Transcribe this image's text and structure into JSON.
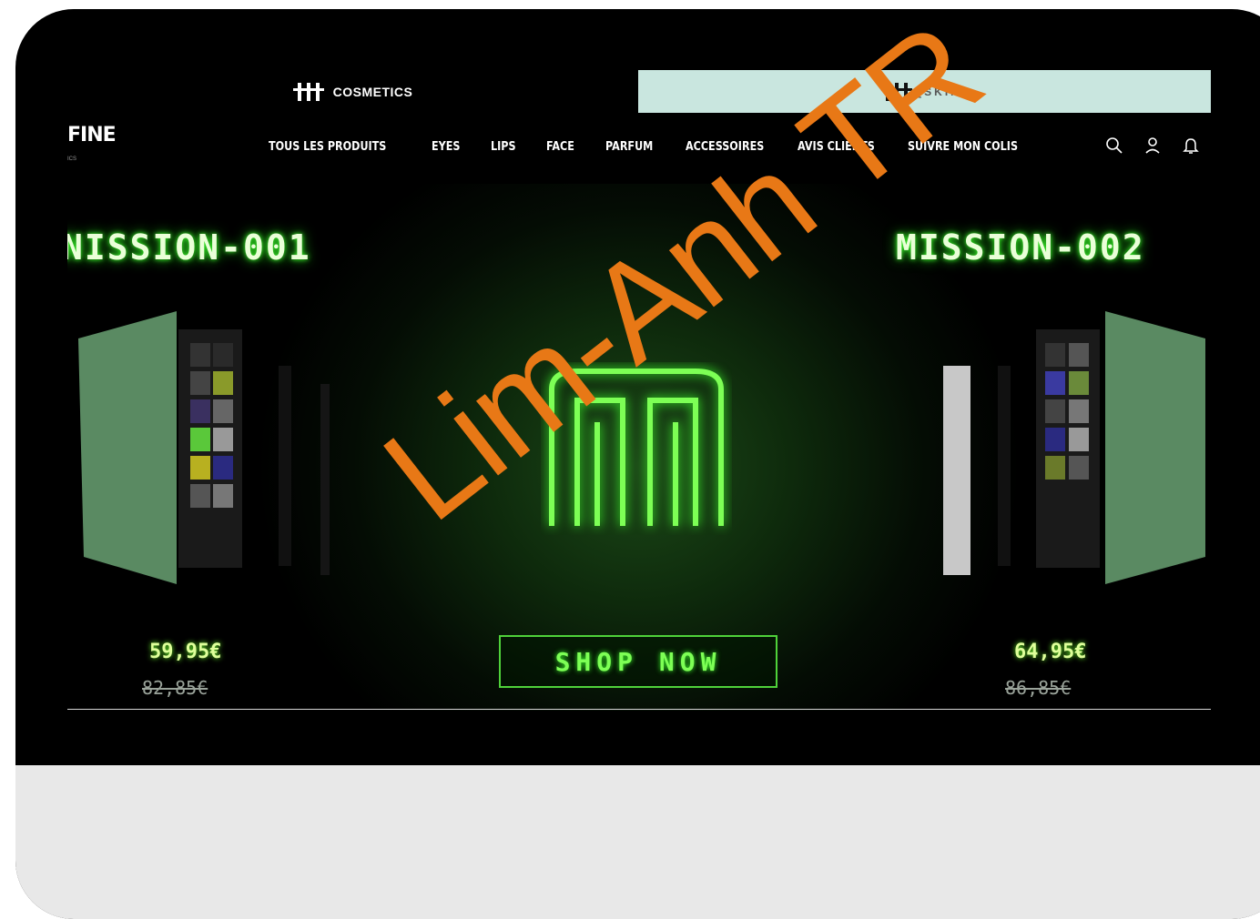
{
  "brand_switch": {
    "cosmetics_label": "COSMETICS",
    "skin_label": "[SKIN]"
  },
  "nav": {
    "logo": "FINE",
    "logo_sub": "ICS",
    "items": [
      {
        "label": "TOUS LES PRODUITS"
      },
      {
        "label": "EYES"
      },
      {
        "label": "LIPS"
      },
      {
        "label": "FACE"
      },
      {
        "label": "PARFUM"
      },
      {
        "label": "ACCESSOIRES"
      },
      {
        "label": "AVIS CLIENTS"
      },
      {
        "label": "SUIVRE MON COLIS"
      }
    ],
    "icons": [
      "search-icon",
      "user-icon",
      "bell-icon"
    ]
  },
  "hero": {
    "mission_left": "NISSION-001",
    "mission_right": "MISSION-002",
    "left_price": "59,95€",
    "left_old_price": "82,85€",
    "right_price": "64,95€",
    "right_old_price": "86,85€",
    "cta_label": "SHOP NOW"
  },
  "watermark": "Lim-Anh TR",
  "colors": {
    "background": "#000000",
    "skin_tab": "#c9e6df",
    "neon_green": "#3cff2a",
    "watermark": "#e87816",
    "bottom_panel": "#e8e8e8"
  }
}
